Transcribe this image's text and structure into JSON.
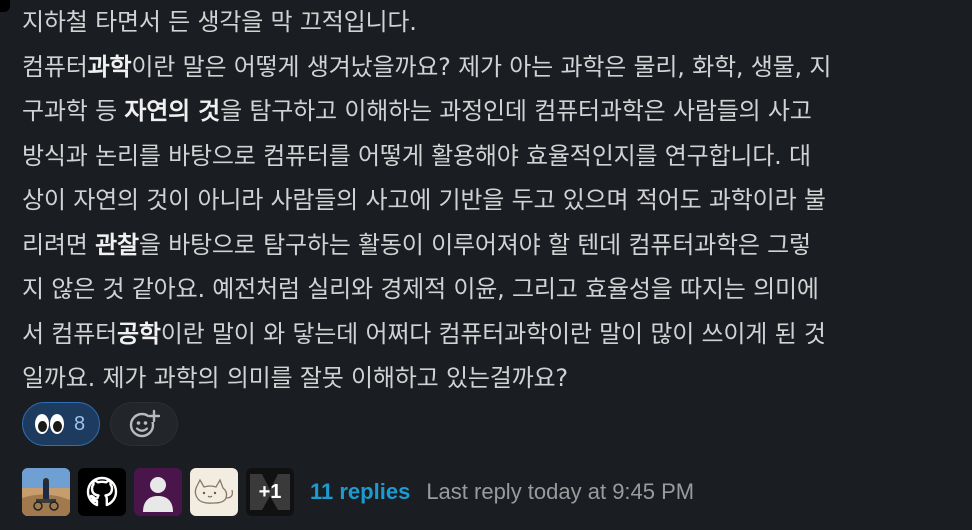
{
  "message": {
    "lines": [
      [
        {
          "t": "지하철 타면서 든 생각을 막 끄적입니다."
        }
      ],
      [
        {
          "t": "컴퓨터"
        },
        {
          "t": "과학",
          "b": true
        },
        {
          "t": "이란 말은 어떻게 생겨났을까요? 제가 아는 과학은 물리, 화학, 생물, 지"
        }
      ],
      [
        {
          "t": "구과학 등 "
        },
        {
          "t": "자연의 것",
          "b": true
        },
        {
          "t": "을 탐구하고 이해하는 과정인데 컴퓨터과학은 사람들의 사고"
        }
      ],
      [
        {
          "t": "방식과 논리를 바탕으로 컴퓨터를 어떻게 활용해야 효율적인지를 연구합니다. 대"
        }
      ],
      [
        {
          "t": "상이 자연의 것이 아니라 사람들의 사고에 기반을 두고 있으며 적어도 과학이라 불"
        }
      ],
      [
        {
          "t": "리려면 "
        },
        {
          "t": "관찰",
          "b": true
        },
        {
          "t": "을 바탕으로 탐구하는 활동이 이루어져야 할 텐데 컴퓨터과학은 그렇"
        }
      ],
      [
        {
          "t": "지 않은 것 같아요. 예전처럼 실리와 경제적 이윤, 그리고 효율성을 따지는 의미에"
        }
      ],
      [
        {
          "t": "서 컴퓨터"
        },
        {
          "t": "공학",
          "b": true
        },
        {
          "t": "이란 말이 와 닿는데 어쩌다 컴퓨터과학이란 말이 많이 쓰이게 된 것"
        }
      ],
      [
        {
          "t": "일까요. 제가 과학의 의미를 잘못 이해하고 있는걸까요?"
        }
      ]
    ]
  },
  "reactions": {
    "eyes": {
      "emoji": "eyes",
      "count": "8"
    },
    "add_reaction_icon": "add-reaction-icon"
  },
  "thread": {
    "avatars": [
      "photo-avatar",
      "github-avatar",
      "default-user-avatar",
      "cat-sketch-avatar"
    ],
    "more_label": "+1",
    "replies_label": "11 replies",
    "last_reply_label": "Last reply today at 9:45 PM"
  },
  "colors": {
    "background": "#1a1d21",
    "text": "#d1d2d3",
    "reaction_bg": "#1d3b5e",
    "reaction_border": "#2f6fb3",
    "link": "#1d9bd1",
    "muted": "#9a9b9d"
  }
}
